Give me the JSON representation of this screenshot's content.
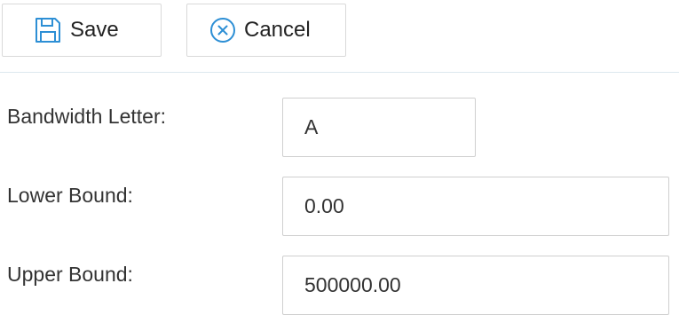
{
  "toolbar": {
    "save_label": "Save",
    "cancel_label": "Cancel",
    "save_icon": "floppy-disk-icon",
    "cancel_icon": "circle-x-icon",
    "icon_color": "#2d8fd5"
  },
  "form": {
    "bandwidth_letter": {
      "label": "Bandwidth Letter:",
      "value": "A"
    },
    "lower_bound": {
      "label": "Lower Bound:",
      "value": "0.00"
    },
    "upper_bound": {
      "label": "Upper Bound:",
      "value": "500000.00"
    }
  }
}
